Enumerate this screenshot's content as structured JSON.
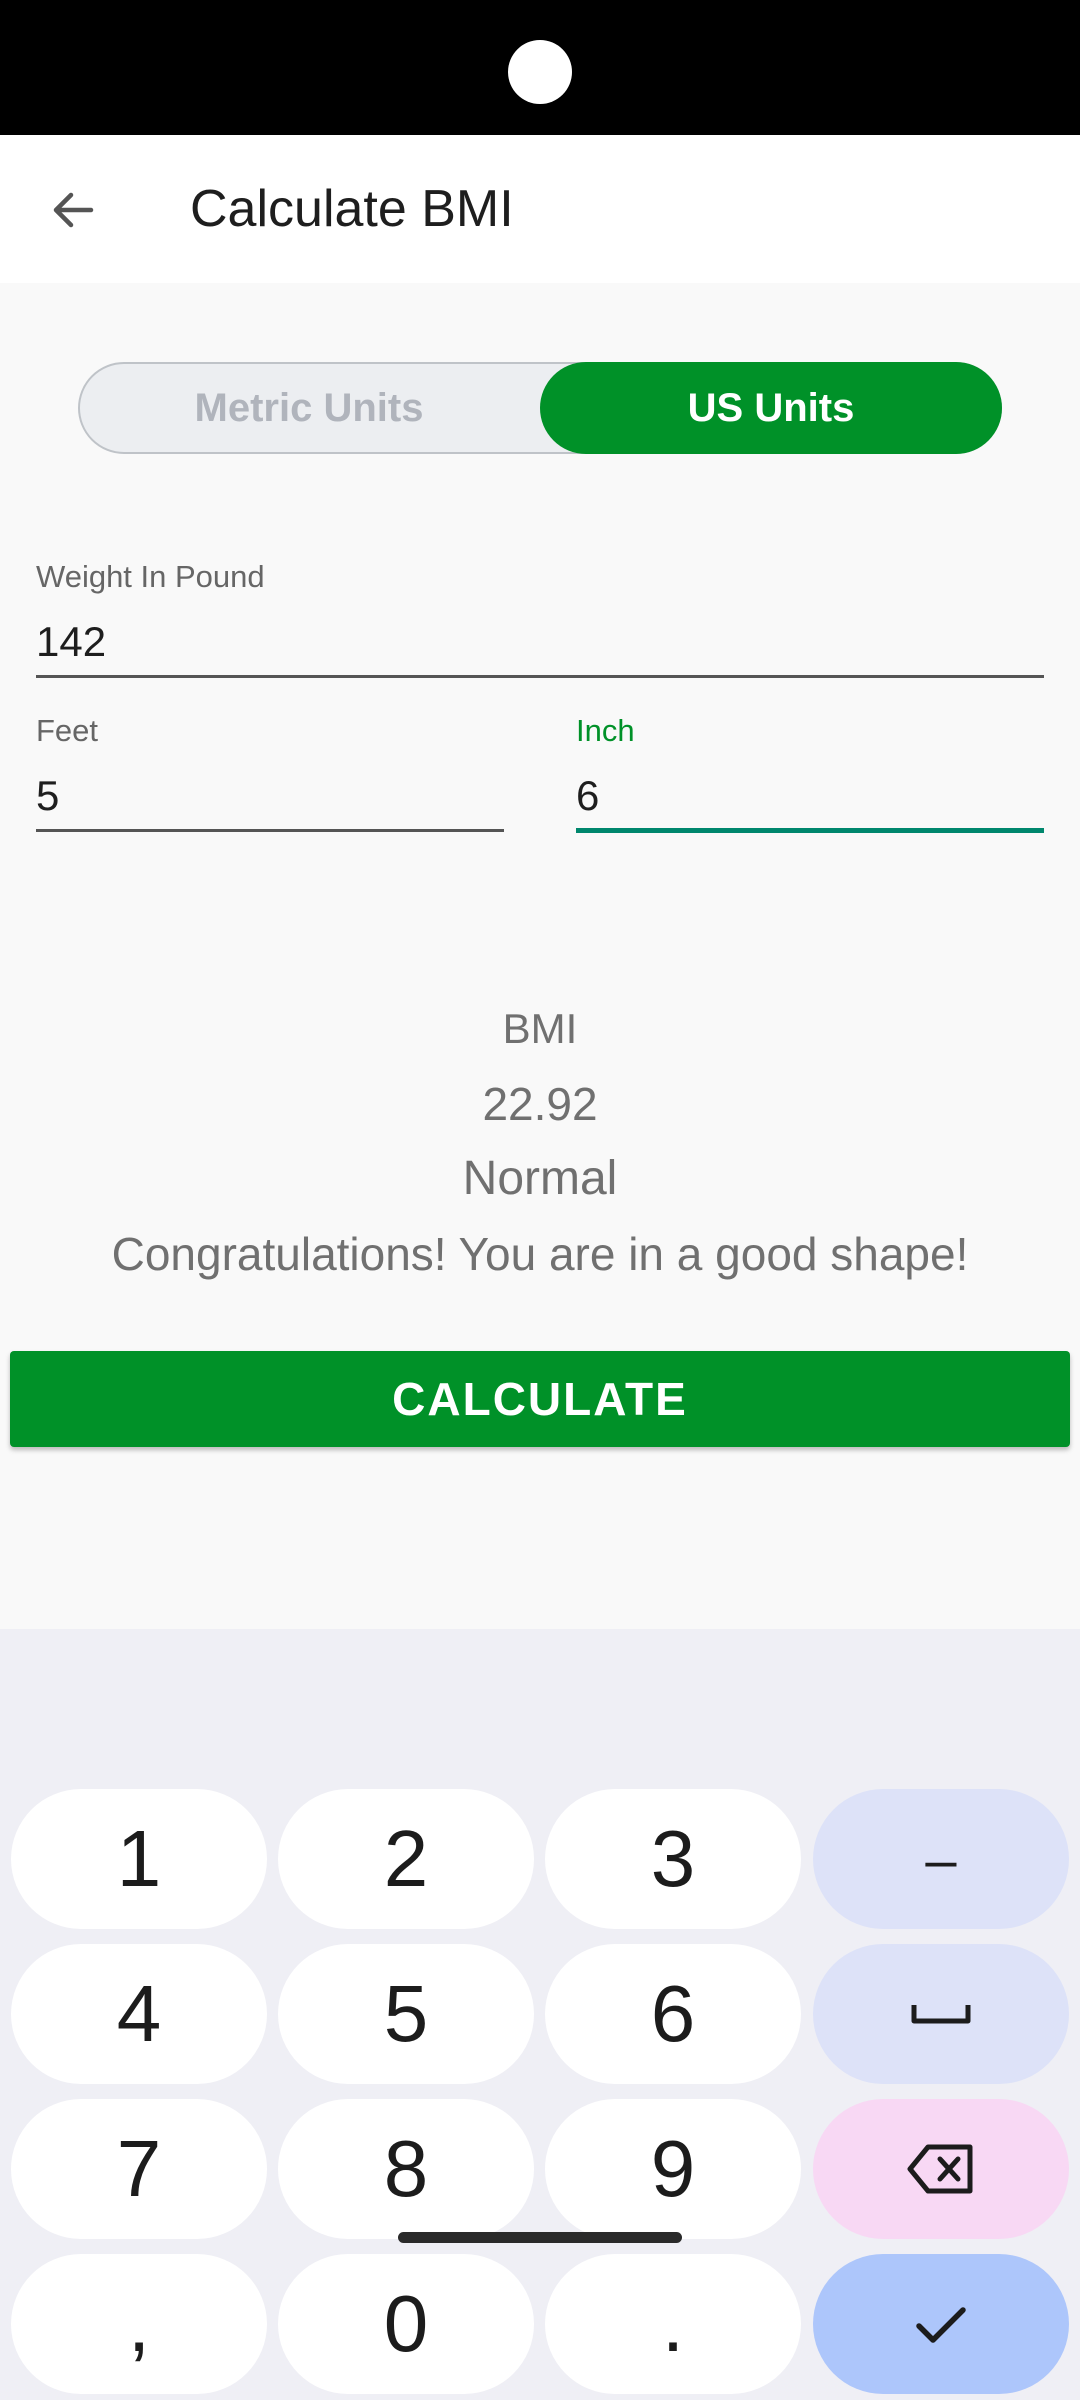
{
  "app_bar": {
    "title": "Calculate BMI"
  },
  "unit_toggle": {
    "options": [
      "Metric Units",
      "US Units"
    ],
    "selected": "US Units"
  },
  "fields": {
    "weight": {
      "label": "Weight In Pound",
      "value": "142"
    },
    "feet": {
      "label": "Feet",
      "value": "5"
    },
    "inch": {
      "label": "Inch",
      "value": "6"
    }
  },
  "result": {
    "heading": "BMI",
    "value": "22.92",
    "category": "Normal",
    "message": "Congratulations! You are in a good shape!"
  },
  "calculate_button": {
    "label": "CALCULATE"
  },
  "keyboard": {
    "keys": [
      "1",
      "2",
      "3",
      "–",
      "4",
      "5",
      "6",
      "␣",
      "7",
      "8",
      "9",
      "backspace",
      ",",
      "0",
      ".",
      "done"
    ]
  },
  "colors": {
    "accent_green": "#009128",
    "focus_underline": "#00876d",
    "inch_label": "#009128"
  }
}
